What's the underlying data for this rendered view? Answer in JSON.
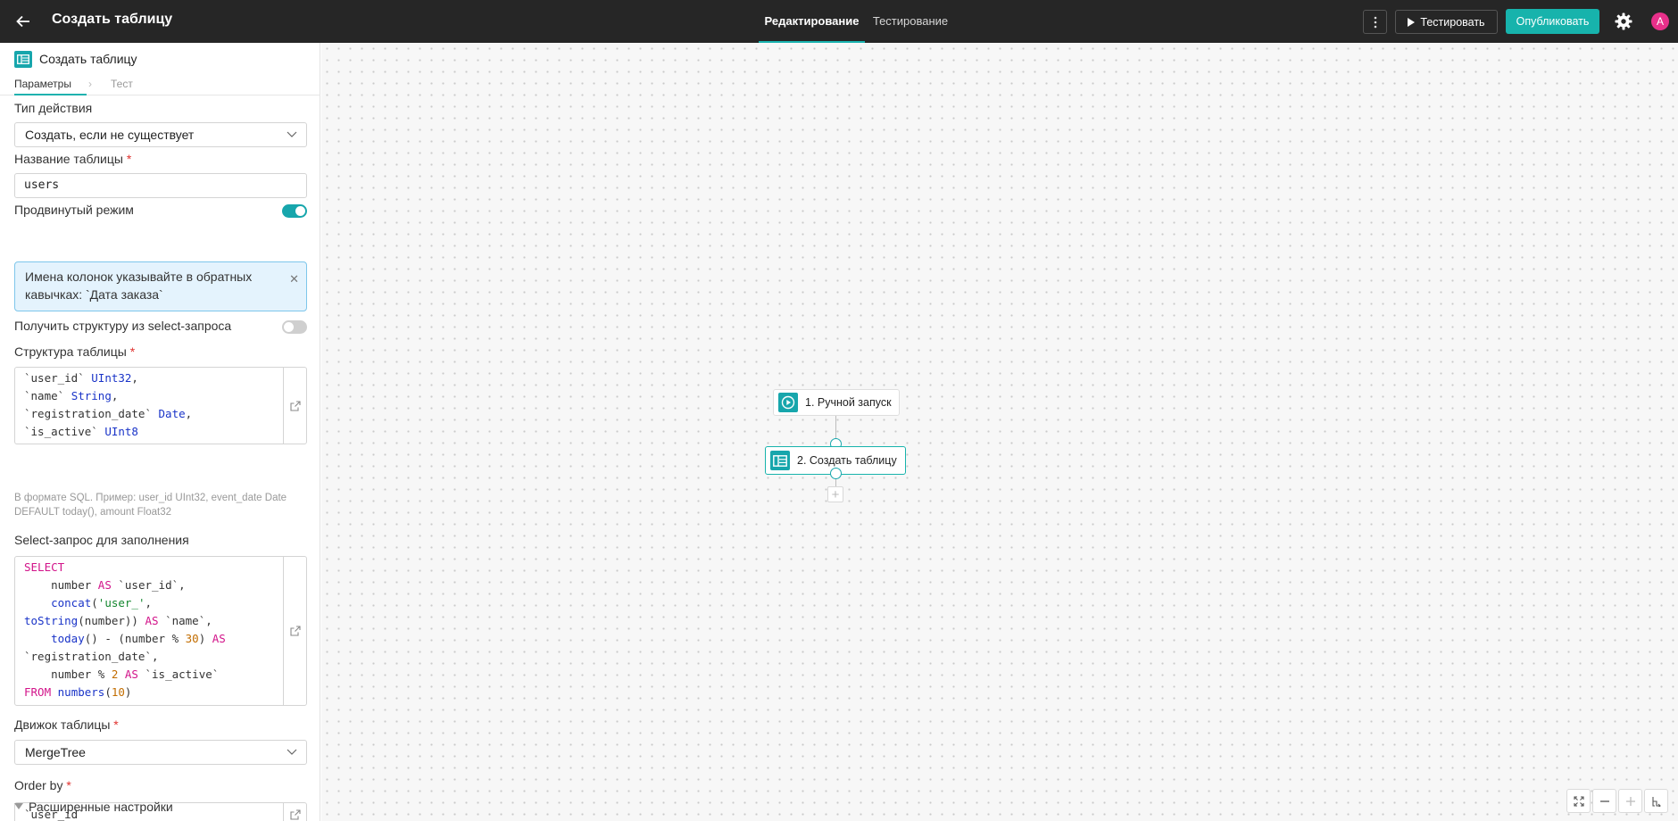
{
  "header": {
    "title": "Создать таблицу",
    "tabs": [
      "Редактирование",
      "Тестирование"
    ],
    "test_label": "Тестировать",
    "publish_label": "Опубликовать",
    "avatar_initial": "A",
    "accent_color": "#17b3ac"
  },
  "panel": {
    "title": "Создать таблицу",
    "tabs": [
      "Параметры",
      "Тест"
    ],
    "action_type": {
      "label": "Тип действия",
      "value": "Создать, если не существует"
    },
    "table_name": {
      "label": "Название таблицы",
      "value": "users"
    },
    "advanced_mode": {
      "label": "Продвинутый режим",
      "on": true
    },
    "info_text": "Имена колонок указывайте в обратных кавычках: `Дата заказа`",
    "structure_from_select": {
      "label": "Получить структуру из select-запроса",
      "on": false
    },
    "structure": {
      "label": "Структура таблицы",
      "hint": "В формате SQL. Пример: user_id UInt32, event_date Date DEFAULT today(), amount Float32"
    },
    "select_query": {
      "label": "Select-запрос для заполнения"
    },
    "engine": {
      "label": "Движок таблицы",
      "value": "MergeTree"
    },
    "order_by": {
      "label": "Order by",
      "value": "`user_id`"
    },
    "advanced_settings": "Расширенные настройки",
    "required_mark": "*"
  },
  "canvas": {
    "nodes": [
      {
        "label": "1. Ручной запуск",
        "icon": "play-circle-icon"
      },
      {
        "label": "2. Создать таблицу",
        "icon": "table-icon"
      }
    ]
  }
}
